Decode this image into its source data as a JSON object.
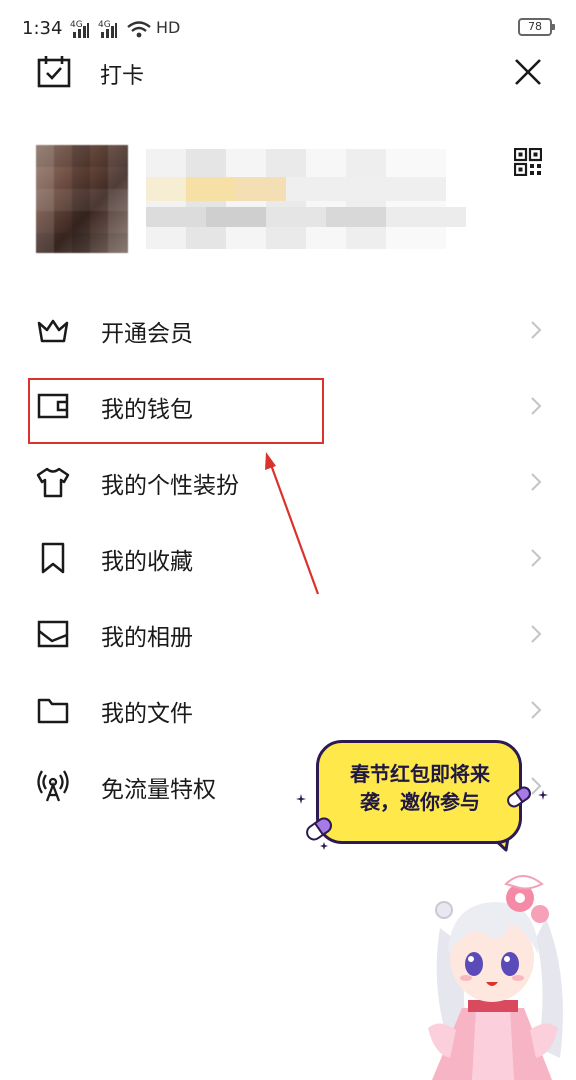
{
  "status_bar": {
    "time": "1:34",
    "signal1": "4G",
    "signal2": "4G",
    "hd": "HD",
    "battery": "78"
  },
  "header": {
    "checkin_label": "打卡"
  },
  "menu": {
    "items": [
      {
        "label": "开通会员",
        "icon": "crown-icon"
      },
      {
        "label": "我的钱包",
        "icon": "wallet-icon"
      },
      {
        "label": "我的个性装扮",
        "icon": "tshirt-icon"
      },
      {
        "label": "我的收藏",
        "icon": "bookmark-icon"
      },
      {
        "label": "我的相册",
        "icon": "photo-icon"
      },
      {
        "label": "我的文件",
        "icon": "folder-icon"
      },
      {
        "label": "免流量特权",
        "icon": "broadcast-icon"
      }
    ]
  },
  "promo": {
    "line1": "春节红包即将来",
    "line2": "袭，邀你参与"
  },
  "colors": {
    "highlight": "#d9332c",
    "bubble_fill": "#ffe84a",
    "bubble_border": "#2c1b52"
  }
}
